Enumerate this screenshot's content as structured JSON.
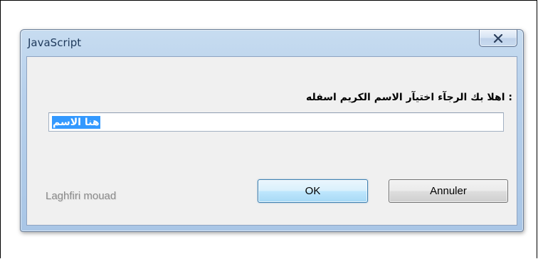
{
  "window": {
    "title": "JavaScript",
    "close_icon": "close-x-icon"
  },
  "prompt": {
    "message": ": اهلا بك الرجآء اختيآر الاسم الكريم اسفله",
    "input_value": "هنا الاسم"
  },
  "watermark": "Laghfiri mouad",
  "buttons": {
    "ok": "OK",
    "cancel": "Annuler"
  },
  "colors": {
    "selection": "#3399ff",
    "frame": "#b8d1ec",
    "ok_button_tint": "#bee6fd"
  }
}
